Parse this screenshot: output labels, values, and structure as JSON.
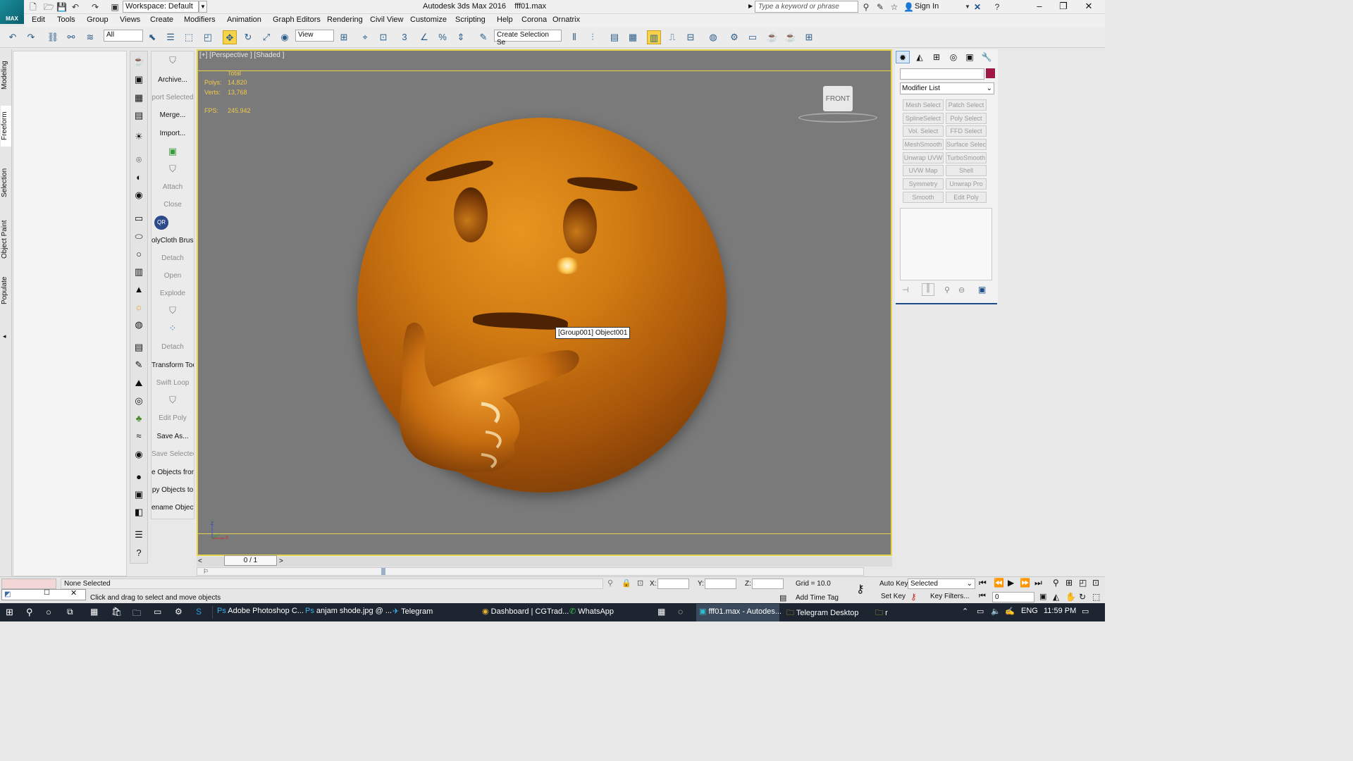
{
  "app": {
    "logo": "MAX",
    "workspace": "Workspace: Default",
    "title": "Autodesk 3ds Max 2016",
    "file": "fff01.max",
    "search_placeholder": "Type a keyword or phrase",
    "sign_in": "Sign In"
  },
  "menus": [
    "Edit",
    "Tools",
    "Group",
    "Views",
    "Create",
    "Modifiers",
    "Animation",
    "Graph Editors",
    "Rendering",
    "Civil View",
    "Customize",
    "Scripting",
    "Help",
    "Corona",
    "Ornatrix"
  ],
  "toolbar": {
    "filter": "All",
    "ref_coord": "View",
    "snap_label": "3",
    "named_sel": "Create Selection Se"
  },
  "ribbon_tabs": [
    "Modeling",
    "Freeform",
    "Selection",
    "Object Paint",
    "Populate"
  ],
  "commands": [
    "Archive...",
    "port Selected",
    "Merge...",
    "Import...",
    "Attach",
    "Close",
    "olyCloth Brushe",
    "Detach",
    "Open",
    "Explode",
    "Detach",
    "Transform Tool",
    "Swift Loop",
    "Edit Poly",
    "Save As...",
    "Save Selected",
    "e Objects from",
    "py Objects to",
    "ename Objects"
  ],
  "viewport": {
    "label": "[+] [Perspective ] [Shaded ]",
    "stats": {
      "total": "Total",
      "polys_label": "Polys:",
      "polys": "14,820",
      "verts_label": "Verts:",
      "verts": "13,768",
      "fps_label": "FPS:",
      "fps": "245.942"
    },
    "tooltip": "[Group001] Object001",
    "viewcube": "FRONT",
    "axis_z": "z",
    "axis_x": "x"
  },
  "command_panel": {
    "modifier_list": "Modifier List",
    "buttons": [
      "Mesh Select",
      "Patch Select",
      "SplineSelect",
      "Poly Select",
      "Vol. Select",
      "FFD Select",
      "MeshSmooth",
      "Surface Select",
      "Unwrap UVW",
      "TurboSmooth",
      "UVW Map",
      "Shell",
      "Symmetry",
      "Unwrap Pro",
      "Smooth",
      "Edit Poly"
    ]
  },
  "timeline": {
    "frame": "0 / 1"
  },
  "status": {
    "selection": "None Selected",
    "prompt": "Click and drag to select and move objects",
    "x": "X:",
    "y": "Y:",
    "z": "Z:",
    "grid": "Grid = 10.0",
    "auto_key": "Auto Key",
    "selected": "Selected",
    "set_key": "Set Key",
    "key_filters": "Key Filters...",
    "add_time_tag": "Add Time Tag",
    "frame_value": "0"
  },
  "taskbar": {
    "items": [
      "Adobe Photoshop C...",
      "anjam shode.jpg @ ...",
      "Telegram",
      "Dashboard | CGTrad...",
      "WhatsApp",
      "fff01.max - Autodes...",
      "Telegram Desktop",
      "r"
    ],
    "lang": "ENG",
    "time": "11:59 PM"
  },
  "colors": {
    "viewport_bg": "#7a7a7a",
    "active_border": "#e5d44a",
    "emoji": "#d07a12",
    "stats": "#f0c94a"
  }
}
